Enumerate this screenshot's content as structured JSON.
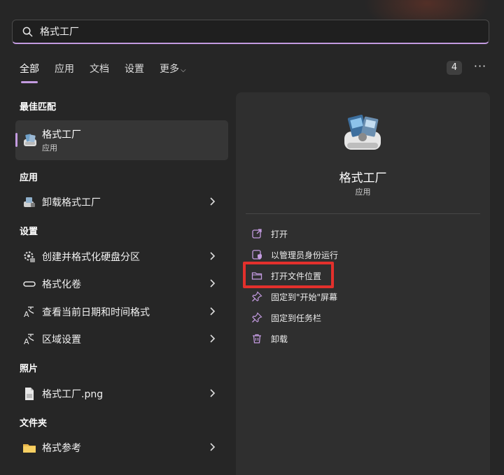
{
  "search": {
    "query": "格式工厂"
  },
  "tabs": [
    {
      "label": "全部",
      "active": true
    },
    {
      "label": "应用"
    },
    {
      "label": "文档"
    },
    {
      "label": "设置"
    },
    {
      "label": "更多"
    }
  ],
  "result_count": "4",
  "sections": {
    "best_match": "最佳匹配",
    "apps": "应用",
    "settings": "设置",
    "photos": "照片",
    "folders": "文件夹"
  },
  "best_match": {
    "name": "格式工厂",
    "type": "应用"
  },
  "apps": [
    {
      "label": "卸载格式工厂"
    }
  ],
  "settings": [
    {
      "label": "创建并格式化硬盘分区"
    },
    {
      "label": "格式化卷"
    },
    {
      "label": "查看当前日期和时间格式"
    },
    {
      "label": "区域设置"
    }
  ],
  "photos": [
    {
      "label": "格式工厂.png"
    }
  ],
  "folders": [
    {
      "label": "格式参考"
    }
  ],
  "detail": {
    "name": "格式工厂",
    "type": "应用",
    "actions": [
      {
        "label": "打开",
        "icon": "open-external-icon"
      },
      {
        "label": "以管理员身份运行",
        "icon": "admin-shield-icon"
      },
      {
        "label": "打开文件位置",
        "icon": "folder-icon"
      },
      {
        "label": "固定到\"开始\"屏幕",
        "icon": "pin-icon"
      },
      {
        "label": "固定到任务栏",
        "icon": "pin-icon"
      },
      {
        "label": "卸载",
        "icon": "trash-icon"
      }
    ]
  },
  "colors": {
    "accent": "#c39be0",
    "highlight": "#e3302c",
    "background": "#262626",
    "panel": "#2f2f2f"
  }
}
